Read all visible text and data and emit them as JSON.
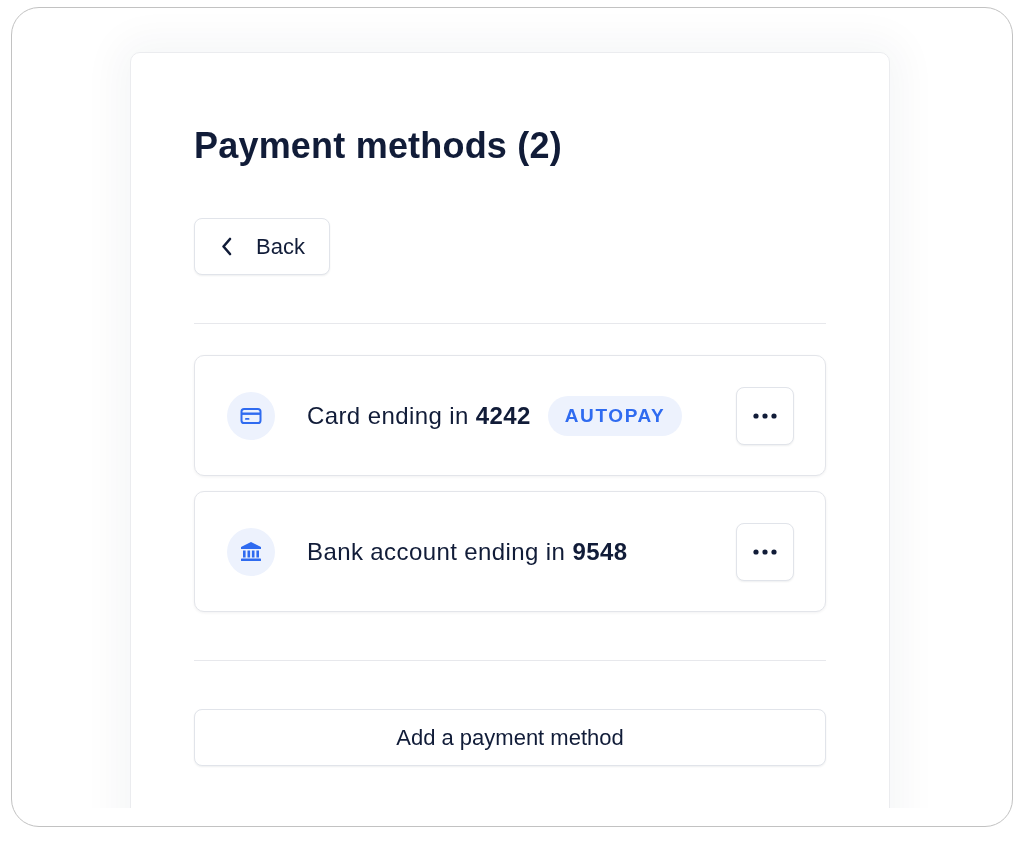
{
  "title": "Payment methods (2)",
  "back_button": {
    "label": "Back"
  },
  "methods": [
    {
      "kind": "card",
      "label": "Card ending in **4242**",
      "badge": "AUTOPAY"
    },
    {
      "kind": "bank",
      "label": "Bank account ending in **9548**"
    }
  ],
  "add_button": {
    "label": "Add a payment method"
  }
}
